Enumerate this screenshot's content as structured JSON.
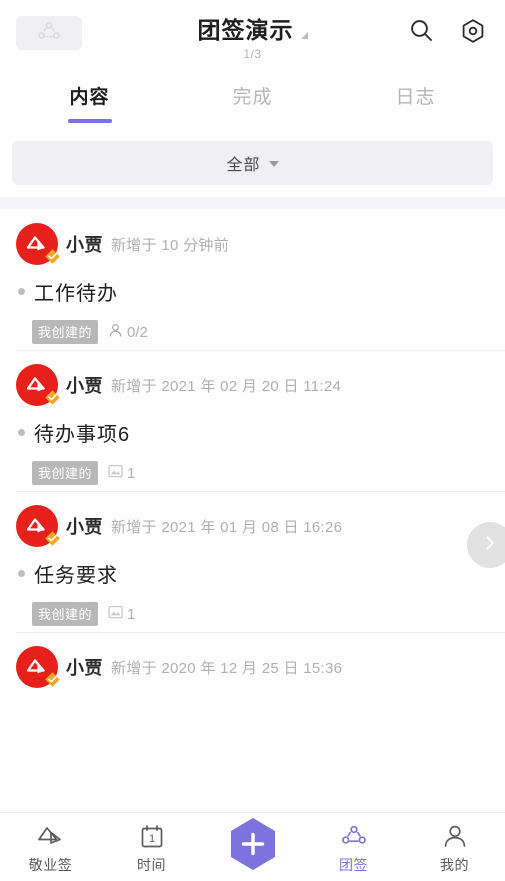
{
  "header": {
    "group_chip_icon": "group-icon",
    "title": "团签演示",
    "page_count": "1/3",
    "search_icon": "search-icon",
    "settings_icon": "hex-settings-icon"
  },
  "tabs": [
    {
      "label": "内容",
      "active": true
    },
    {
      "label": "完成",
      "active": false
    },
    {
      "label": "日志",
      "active": false
    }
  ],
  "filter": {
    "label": "全部",
    "caret_icon": "chevron-down-icon"
  },
  "list": {
    "next_button_icon": "chevron-right-icon",
    "items": [
      {
        "author": "小贾",
        "timestamp": "新增于 10 分钟前",
        "title": "工作待办",
        "tag": "我创建的",
        "counter_icon": "person-icon",
        "counter_value": "0/2"
      },
      {
        "author": "小贾",
        "timestamp": "新增于 2021 年 02 月 20 日 11:24",
        "title": "待办事项6",
        "tag": "我创建的",
        "counter_icon": "image-icon",
        "counter_value": "1"
      },
      {
        "author": "小贾",
        "timestamp": "新增于 2021 年 01 月 08 日 16:26",
        "title": "任务要求",
        "tag": "我创建的",
        "counter_icon": "image-icon",
        "counter_value": "1"
      },
      {
        "author": "小贾",
        "timestamp": "新增于 2020 年 12 月 25 日 15:36",
        "title": "",
        "tag": "",
        "counter_icon": "",
        "counter_value": ""
      }
    ]
  },
  "bottom_nav": {
    "items": [
      {
        "label": "敬业签",
        "icon": "note-icon",
        "active": false
      },
      {
        "label": "时间",
        "icon": "calendar-icon",
        "active": false
      },
      {
        "label": "团签",
        "icon": "group-icon",
        "active": true
      },
      {
        "label": "我的",
        "icon": "person-icon",
        "active": false
      }
    ],
    "center_button": {
      "icon": "plus-icon",
      "label": "新建"
    },
    "calendar_day": "1"
  },
  "colors": {
    "accent_purple": "#7b72dd",
    "avatar_red": "#e8201c",
    "badge_orange": "#f5a623",
    "tag_gray": "#b8b8b8",
    "muted_text": "#b0b0b0"
  }
}
